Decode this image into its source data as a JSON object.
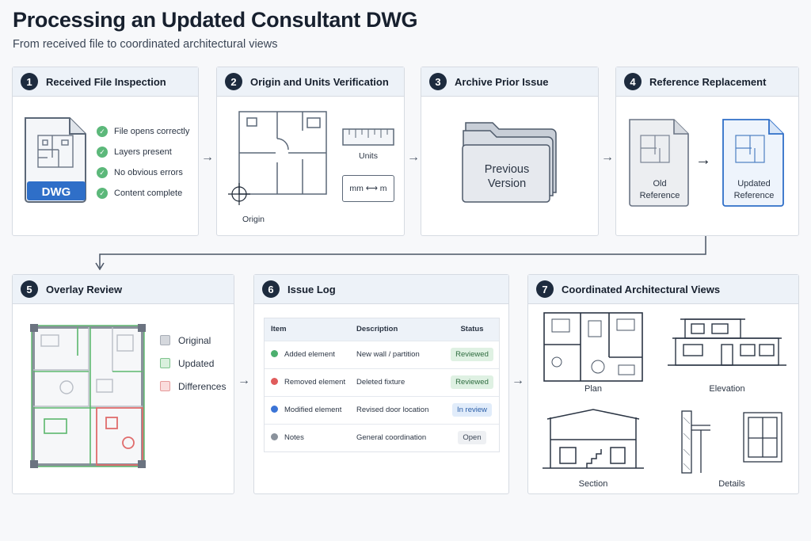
{
  "title": "Processing an Updated Consultant DWG",
  "subtitle": "From received file to coordinated architectural views",
  "steps": [
    {
      "num": "1",
      "title": "Received File Inspection"
    },
    {
      "num": "2",
      "title": "Origin and Units Verification"
    },
    {
      "num": "3",
      "title": "Archive Prior Issue"
    },
    {
      "num": "4",
      "title": "Reference Replacement"
    },
    {
      "num": "5",
      "title": "Overlay Review"
    },
    {
      "num": "6",
      "title": "Issue Log"
    },
    {
      "num": "7",
      "title": "Coordinated Architectural Views"
    }
  ],
  "step1": {
    "file_badge": "DWG",
    "checks": [
      "File opens correctly",
      "Layers present",
      "No obvious errors",
      "Content complete"
    ]
  },
  "step2": {
    "units_label": "Units",
    "conversion": "mm ⟷ m",
    "origin_label": "Origin"
  },
  "step3": {
    "folder_line1": "Previous",
    "folder_line2": "Version"
  },
  "step4": {
    "old_line1": "Old",
    "old_line2": "Reference",
    "new_line1": "Updated",
    "new_line2": "Reference"
  },
  "step5": {
    "legend": [
      "Original",
      "Updated",
      "Differences"
    ]
  },
  "step6": {
    "headers": [
      "Item",
      "Description",
      "Status"
    ],
    "rows": [
      {
        "item": "Added element",
        "description": "New wall / partition",
        "status": "Reviewed"
      },
      {
        "item": "Removed element",
        "description": "Deleted fixture",
        "status": "Reviewed"
      },
      {
        "item": "Modified element",
        "description": "Revised door location",
        "status": "In review"
      },
      {
        "item": "Notes",
        "description": "General coordination",
        "status": "Open"
      }
    ]
  },
  "step7": {
    "views": [
      "Plan",
      "Elevation",
      "Section",
      "Details"
    ]
  },
  "colors": {
    "accent_dark": "#1d2b3e",
    "check_green": "#5cb87a",
    "updated_blue": "#2f6fc8",
    "original_gray": "#b9bec6",
    "updated_green": "#5cb86d",
    "difference_red": "#e06c6c",
    "dot_added": "#4caf6e",
    "dot_removed": "#e05c5c",
    "dot_modified": "#3b74d6",
    "dot_notes": "#8a929c",
    "badge_reviewed_bg": "#dff1e3",
    "badge_inreview_bg": "#e1ecfa",
    "badge_open_bg": "#eef0f3"
  },
  "icons": [
    "dwg-file-icon",
    "check-icon",
    "ruler-icon",
    "origin-crosshair-icon",
    "folder-stack-icon",
    "document-icon",
    "arrow-right-icon"
  ]
}
